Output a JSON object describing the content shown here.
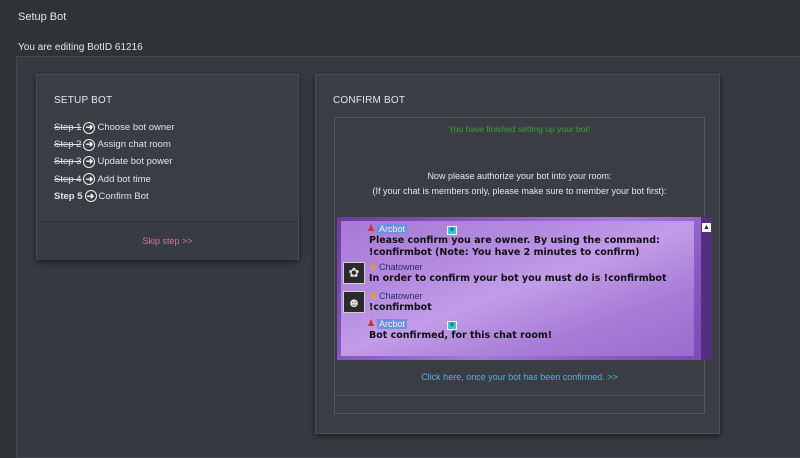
{
  "page": {
    "title": "Setup Bot",
    "editing_text": "You are editing BotID 61216"
  },
  "setup_panel": {
    "title": "SETUP BOT",
    "steps": [
      {
        "num": "Step 1",
        "label": "Choose bot owner",
        "state": "done"
      },
      {
        "num": "Step 2",
        "label": "Assign chat room",
        "state": "done"
      },
      {
        "num": "Step 3",
        "label": "Update bot power",
        "state": "done"
      },
      {
        "num": "Step 4",
        "label": "Add bot time",
        "state": "done"
      },
      {
        "num": "Step 5",
        "label": "Confirm Bot",
        "state": "current"
      }
    ],
    "skip_label": "Skip step >>"
  },
  "confirm_panel": {
    "title": "CONFIRM BOT",
    "finished_text": "You have finished setting up your bot!",
    "authorize_line1": "Now please authorize your bot into your room:",
    "authorize_line2": "(If your chat is members only, please make sure to member your bot first):",
    "chat": {
      "messages": [
        {
          "name": "Arcbot",
          "text": [
            "Please confirm you are owner. By using the command:",
            "!confirmbot  (Note: You have 2 minutes to confirm)"
          ]
        },
        {
          "name": "Chatowner",
          "text": [
            "In order to confirm your bot you must do is !confirmbot"
          ]
        },
        {
          "name": "Chatowner",
          "text": [
            "!confirmbot"
          ]
        },
        {
          "name": "Arcbot",
          "text": [
            "Bot confirmed, for this chat room!"
          ]
        }
      ]
    },
    "confirmed_link": "Click here, once your bot has been confirmed. >>"
  },
  "colors": {
    "background": "#2f3237",
    "panel": "#3a3d43",
    "skip_link": "#e0709a",
    "finished_text": "#3aa23a",
    "confirmed_link": "#5aaedb",
    "chat_purple": "#a97ad4"
  }
}
